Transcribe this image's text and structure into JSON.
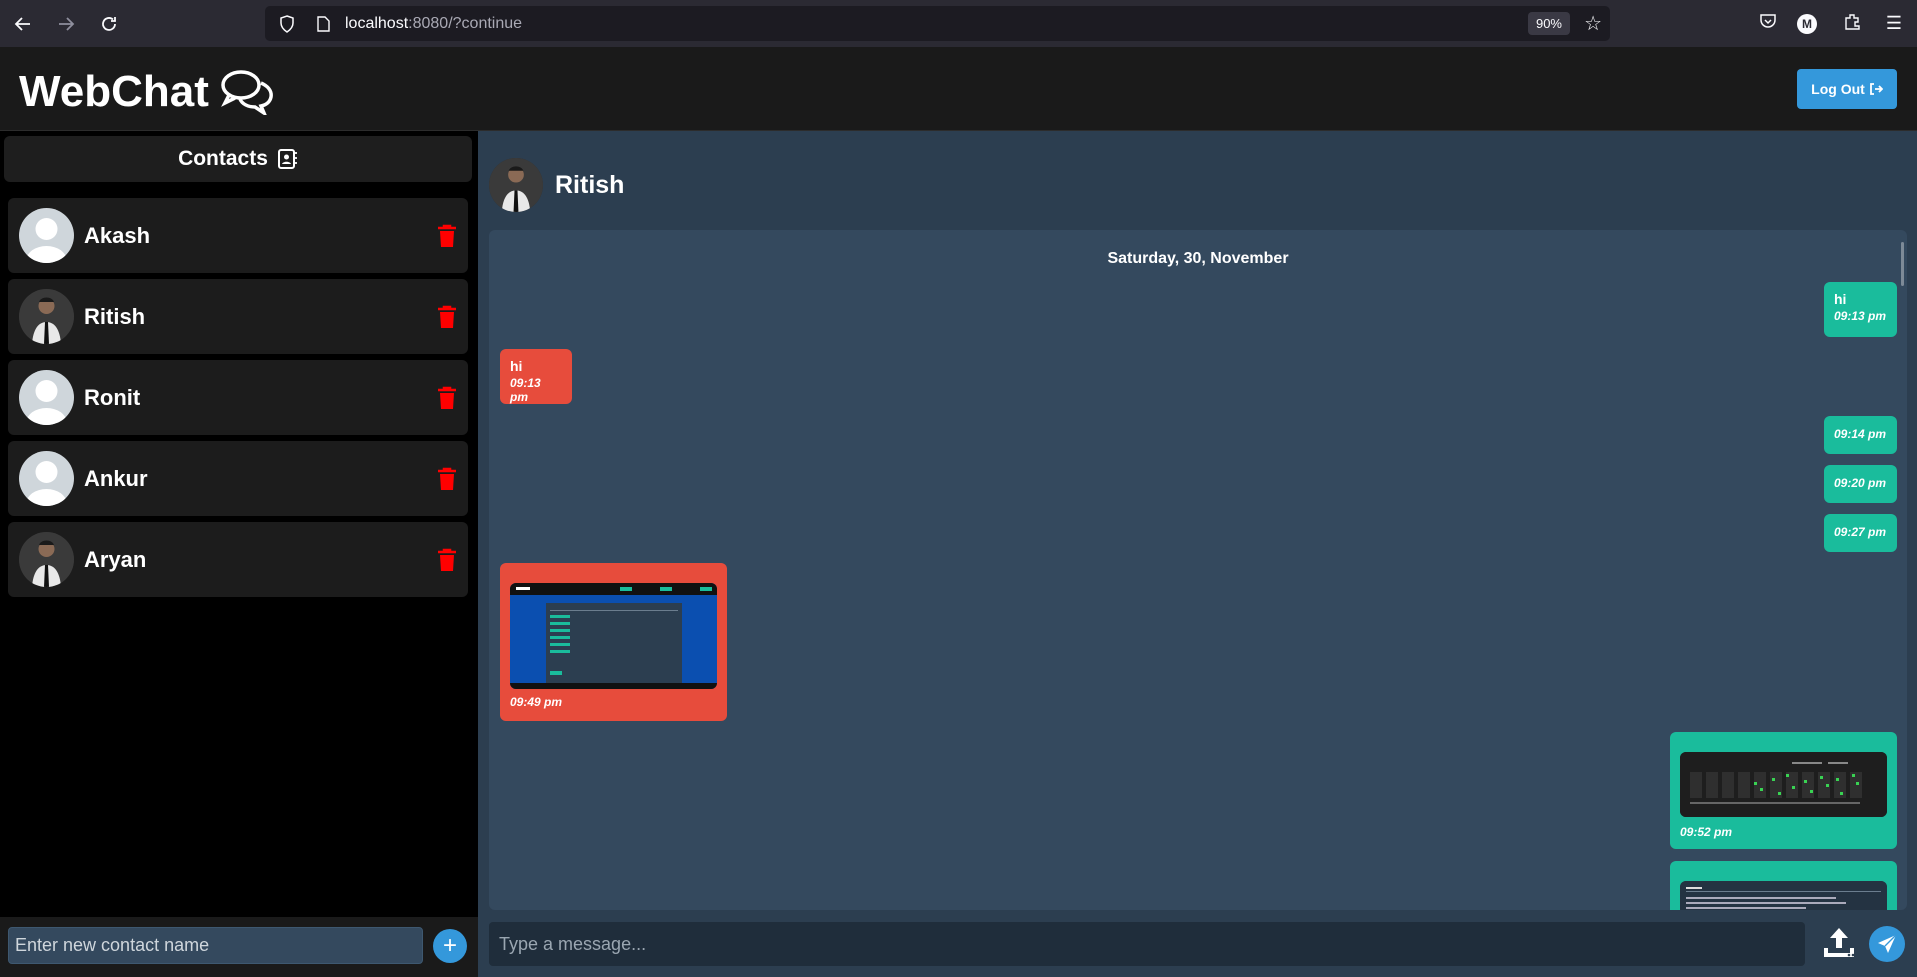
{
  "browser": {
    "url_host": "localhost",
    "url_rest": ":8080/?continue",
    "zoom": "90%",
    "profile_initial": "M"
  },
  "header": {
    "brand": "WebChat",
    "logout_label": "Log Out"
  },
  "sidebar": {
    "title": "Contacts",
    "contacts": [
      {
        "name": "Akash",
        "avatar": "default"
      },
      {
        "name": "Ritish",
        "avatar": "photo"
      },
      {
        "name": "Ronit",
        "avatar": "default"
      },
      {
        "name": "Ankur",
        "avatar": "default"
      },
      {
        "name": "Aryan",
        "avatar": "photo"
      }
    ],
    "new_contact_placeholder": "Enter new contact name",
    "add_label": "+"
  },
  "chat": {
    "contact_name": "Ritish",
    "date": "Saturday, 30, November",
    "messages": [
      {
        "dir": "out",
        "text": "hi",
        "time": "09:13 pm"
      },
      {
        "dir": "in",
        "text": "hi",
        "time": "09:13 pm"
      },
      {
        "dir": "out",
        "text": "",
        "time": "09:14 pm"
      },
      {
        "dir": "out",
        "text": "",
        "time": "09:20 pm"
      },
      {
        "dir": "out",
        "text": "",
        "time": "09:27 pm"
      },
      {
        "dir": "in",
        "text": "",
        "time": "09:49 pm",
        "image": true
      },
      {
        "dir": "out",
        "text": "",
        "time": "09:52 pm",
        "image": true
      },
      {
        "dir": "out",
        "text": "",
        "time": "",
        "image": true
      }
    ],
    "composer_placeholder": "Type a message..."
  },
  "colors": {
    "outgoing": "#1abc9c",
    "incoming": "#e74c3c",
    "accent": "#3498db",
    "delete": "#ff0000"
  }
}
